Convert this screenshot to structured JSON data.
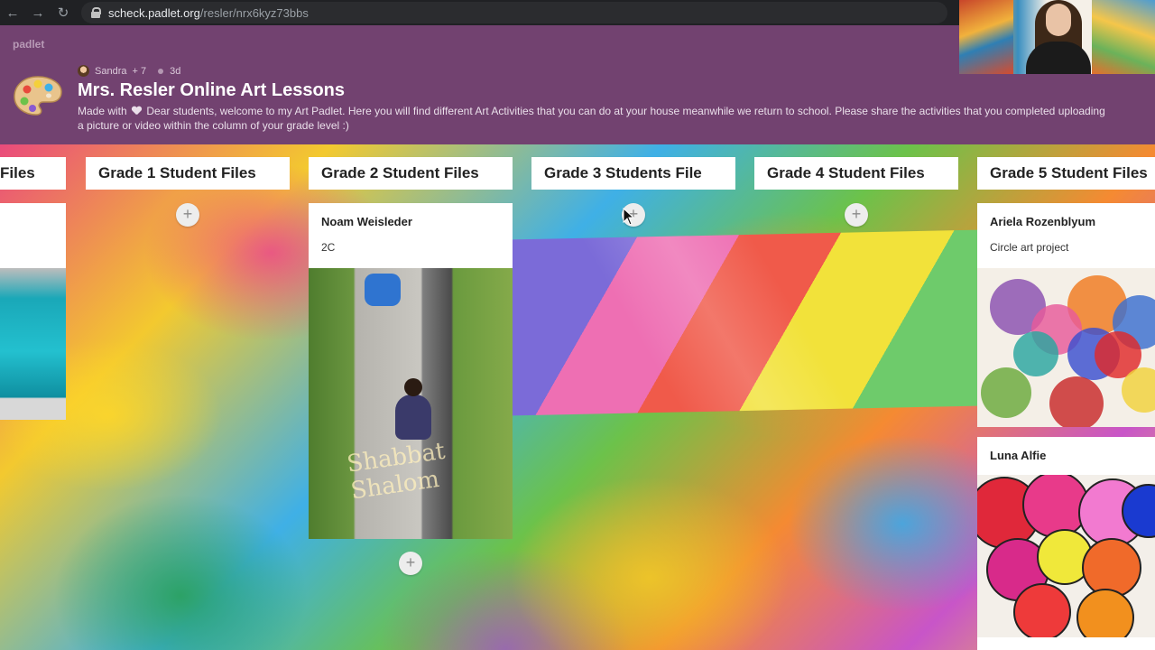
{
  "browser": {
    "url_host": "scheck.padlet.org",
    "url_path": "/resler/nrx6kyz73bbs",
    "back_icon": "←",
    "forward_icon": "→",
    "reload_icon": "↻"
  },
  "header": {
    "brand": "padlet",
    "author": "Sandra",
    "contributors": "+ 7",
    "age": "3d",
    "title": "Mrs. Resler Online Art Lessons",
    "desc_prefix": "Made with",
    "desc_body": "Dear students, welcome to my Art Padlet. Here you will find different Art Activities that you can do at your house meanwhile we return to school. Please share the activities that you completed uploading a picture or video within the column of your grade level :)",
    "colors": {
      "header_bg": "#724270"
    }
  },
  "columns": [
    {
      "title": "Files"
    },
    {
      "title": "Grade 1 Student Files"
    },
    {
      "title": "Grade 2 Student Files"
    },
    {
      "title": "Grade 3 Students File"
    },
    {
      "title": "Grade 4 Student Files"
    },
    {
      "title": "Grade 5 Student Files"
    }
  ],
  "posts": {
    "grade2": {
      "author": "Noam Weisleder",
      "subtitle": "2C",
      "chalk": "Shabbat Shalom"
    },
    "grade5_a": {
      "author": "Ariela Rozenblyum",
      "subtitle": "Circle art project"
    },
    "grade5_b": {
      "author": "Luna Alfie"
    }
  },
  "add_button_label": "+"
}
